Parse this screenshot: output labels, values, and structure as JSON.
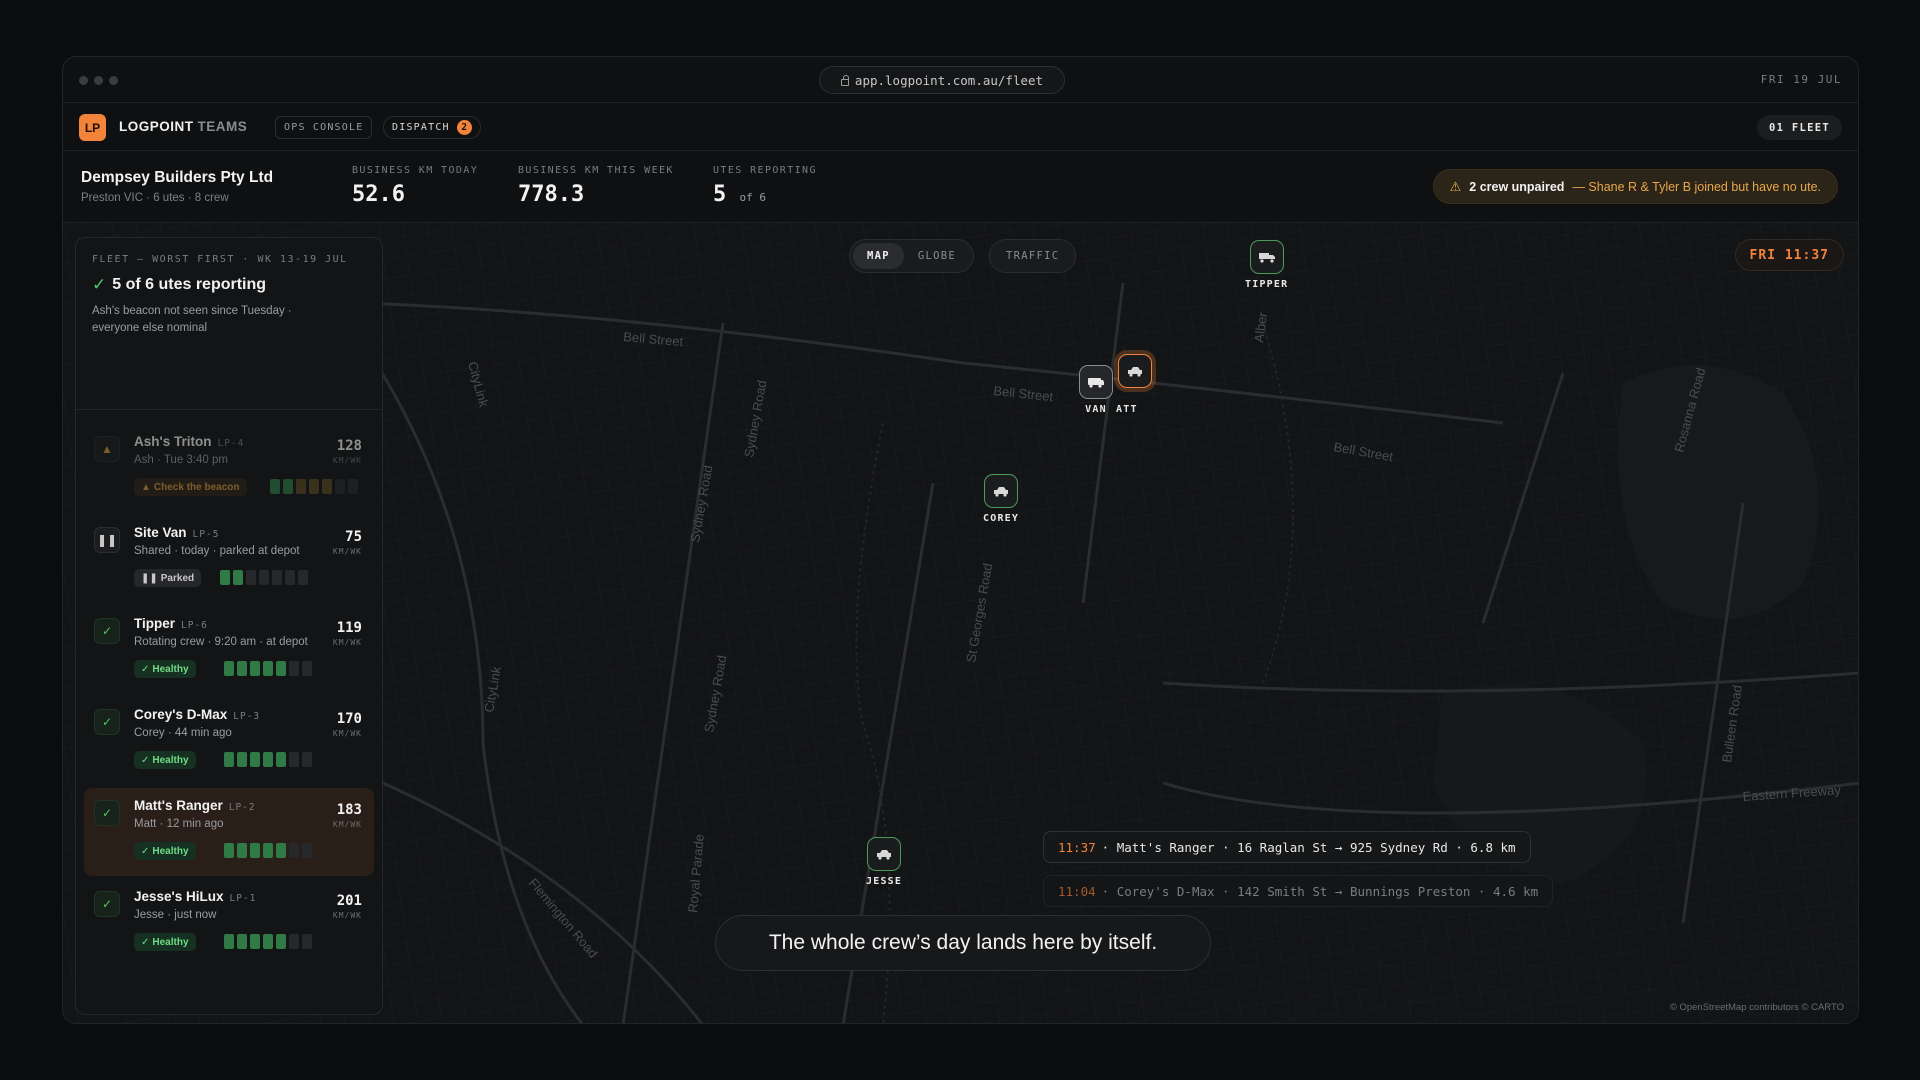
{
  "browser": {
    "url": "app.logpoint.com.au/fleet",
    "date": "FRI 19 JUL"
  },
  "header": {
    "logo": "LP",
    "brand": "LOGPOINT",
    "brand_suffix": "TEAMS",
    "ops_chip": "OPS CONSOLE",
    "dispatch_label": "DISPATCH",
    "dispatch_count": "2",
    "fleet_button": "01 FLEET"
  },
  "company": {
    "name": "Dempsey Builders Pty Ltd",
    "sub": "Preston VIC · 6 utes · 8 crew"
  },
  "stats": [
    {
      "label": "BUSINESS KM TODAY",
      "value": "52.6",
      "suffix": ""
    },
    {
      "label": "BUSINESS KM THIS WEEK",
      "value": "778.3",
      "suffix": ""
    },
    {
      "label": "UTES REPORTING",
      "value": "5",
      "suffix": "of 6"
    }
  ],
  "alert": {
    "strong": "2 crew unpaired",
    "rest": "— Shane R & Tyler B joined but have no ute."
  },
  "map": {
    "toggle": [
      "MAP",
      "GLOBE"
    ],
    "traffic": "TRAFFIC",
    "clock": "FRI 11:37",
    "streets": [
      "Bell Street",
      "Bell Street",
      "Bell Street",
      "Sydney Road",
      "Sydney Road",
      "Sydney Road",
      "St Georges Road",
      "Royal Parade",
      "Flemington Road",
      "Eastern Freeway",
      "Rosanna Road",
      "CityLink",
      "CityLink",
      "Alber",
      "Bulleen Road"
    ],
    "vehicles": [
      {
        "label": "TIPPER"
      },
      {
        "label": "VAN"
      },
      {
        "label": "ATT"
      },
      {
        "label": "COREY"
      },
      {
        "label": "JESSE"
      }
    ],
    "trips": [
      {
        "time": "11:37",
        "text": "· Matt's Ranger · 16 Raglan St → 925 Sydney Rd · 6.8 km"
      },
      {
        "time": "11:04",
        "text": "· Corey's D-Max · 142 Smith St → Bunnings Preston · 4.6 km"
      }
    ],
    "caption": "The whole crew’s day lands here by itself.",
    "credit": "© OpenStreetMap contributors © CARTO"
  },
  "panel": {
    "overline": "FLEET — WORST FIRST · WK 13-19 JUL",
    "headline": "5 of 6 utes reporting",
    "description": "Ash's beacon not seen since Tuesday · everyone else nominal",
    "vehicles": [
      {
        "name": "Ash's Triton",
        "plate": "LP-4",
        "sub": "Ash · Tue 3:40 pm",
        "status": "Check the beacon",
        "km": "128",
        "unit": "KM/WK",
        "bars_on": 5
      },
      {
        "name": "Site Van",
        "plate": "LP-5",
        "sub": "Shared · today · parked at depot",
        "status": "Parked",
        "km": "75",
        "unit": "KM/WK",
        "bars_on": 2
      },
      {
        "name": "Tipper",
        "plate": "LP-6",
        "sub": "Rotating crew · 9:20 am · at depot",
        "status": "Healthy",
        "km": "119",
        "unit": "KM/WK",
        "bars_on": 5
      },
      {
        "name": "Corey's D-Max",
        "plate": "LP-3",
        "sub": "Corey · 44 min ago",
        "status": "Healthy",
        "km": "170",
        "unit": "KM/WK",
        "bars_on": 5
      },
      {
        "name": "Matt's Ranger",
        "plate": "LP-2",
        "sub": "Matt · 12 min ago",
        "status": "Healthy",
        "km": "183",
        "unit": "KM/WK",
        "bars_on": 5
      },
      {
        "name": "Jesse's HiLux",
        "plate": "LP-1",
        "sub": "Jesse · just now",
        "status": "Healthy",
        "km": "201",
        "unit": "KM/WK",
        "bars_on": 5
      }
    ]
  },
  "colors": {
    "accent": "#f2833a",
    "ok": "#4cc766",
    "warn": "#e8b04a"
  }
}
